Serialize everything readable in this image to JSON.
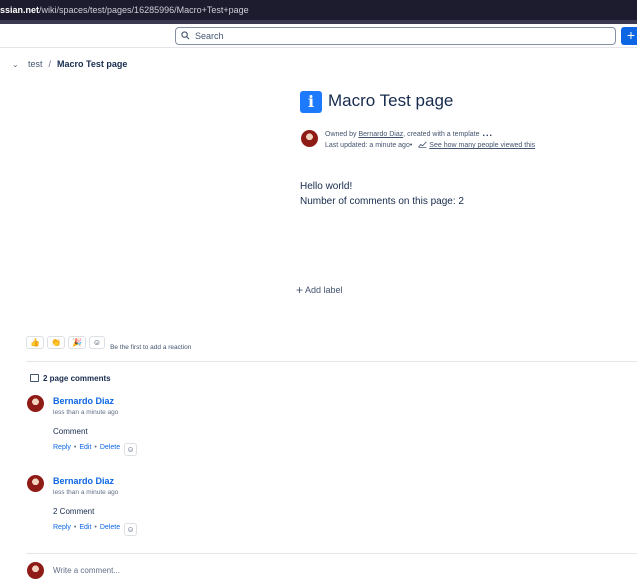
{
  "browser": {
    "url_host": "ssian.net",
    "url_path": "/wiki/spaces/test/pages/16285996/Macro+Test+page"
  },
  "topnav": {
    "search_placeholder": "Search",
    "create_label": "+"
  },
  "breadcrumb": {
    "space": "test",
    "separator": "/",
    "current": "Macro Test page"
  },
  "page": {
    "title": "Macro Test page",
    "title_icon": "info-icon",
    "byline": {
      "owned_prefix": "Owned by ",
      "owner": "Bernardo Diaz",
      "created_suffix": ", created with a template",
      "more": "...",
      "last_updated": "Last updated: a minute ago",
      "bullet": "•",
      "views_link": "See how many people viewed this"
    },
    "body": [
      "Hello world!",
      "Number of comments on this page: 2"
    ],
    "add_label": "Add label"
  },
  "reactions": {
    "items": [
      {
        "emoji": "👍",
        "name": "thumbs-up-reaction"
      },
      {
        "emoji": "👏",
        "name": "clap-reaction"
      },
      {
        "emoji": "🎉",
        "name": "party-reaction"
      }
    ],
    "add_emoji_icon": "emoji-add-icon",
    "prompt": "Be the first to add a reaction"
  },
  "comments": {
    "header": "2 page comments",
    "items": [
      {
        "author": "Bernardo Diaz",
        "time": "less than a minute ago",
        "body": "Comment",
        "actions": [
          "Reply",
          "Edit",
          "Delete"
        ]
      },
      {
        "author": "Bernardo Diaz",
        "time": "less than a minute ago",
        "body": "2 Comment",
        "actions": [
          "Reply",
          "Edit",
          "Delete"
        ]
      }
    ],
    "write_placeholder": "Write a comment..."
  },
  "colors": {
    "accent": "#0c66e4",
    "info_icon": "#1d7afc",
    "text": "#172b4d",
    "subtle": "#44546f"
  }
}
